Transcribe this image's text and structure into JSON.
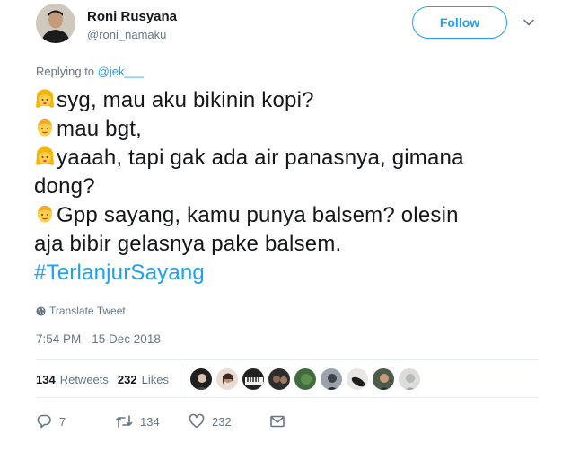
{
  "author": {
    "display_name": "Roni Rusyana",
    "handle": "@roni_namaku"
  },
  "follow_button": {
    "label": "Follow"
  },
  "reply": {
    "prefix": "Replying to ",
    "mention": "@jek___"
  },
  "tweet": {
    "lines": [
      {
        "emoji": "girl-emoji",
        "text": "syg, mau aku bikinin kopi?"
      },
      {
        "emoji": "boy-emoji",
        "text": "mau bgt,"
      },
      {
        "emoji": "girl-emoji",
        "text": "yaaah, tapi gak ada air panasnya, gimana"
      },
      {
        "emoji": "",
        "text": "dong?"
      },
      {
        "emoji": "boy-emoji",
        "text": "Gpp sayang, kamu punya balsem? olesin"
      },
      {
        "emoji": "",
        "text": "aja bibir gelasnya pake balsem."
      }
    ],
    "hashtag": "#TerlanjurSayang"
  },
  "translate": {
    "label": "Translate Tweet",
    "icon": "globe-icon"
  },
  "timestamp": "7:54 PM - 15 Dec 2018",
  "stats": {
    "retweets_count": "134",
    "retweets_label": "Retweets",
    "likes_count": "232",
    "likes_label": "Likes"
  },
  "actions": {
    "reply_count": "7",
    "retweet_count": "134",
    "like_count": "232"
  },
  "colors": {
    "accent": "#1da1f2",
    "secondary_text": "#657786",
    "primary_text": "#14171a",
    "divider": "#e6ecf0"
  }
}
